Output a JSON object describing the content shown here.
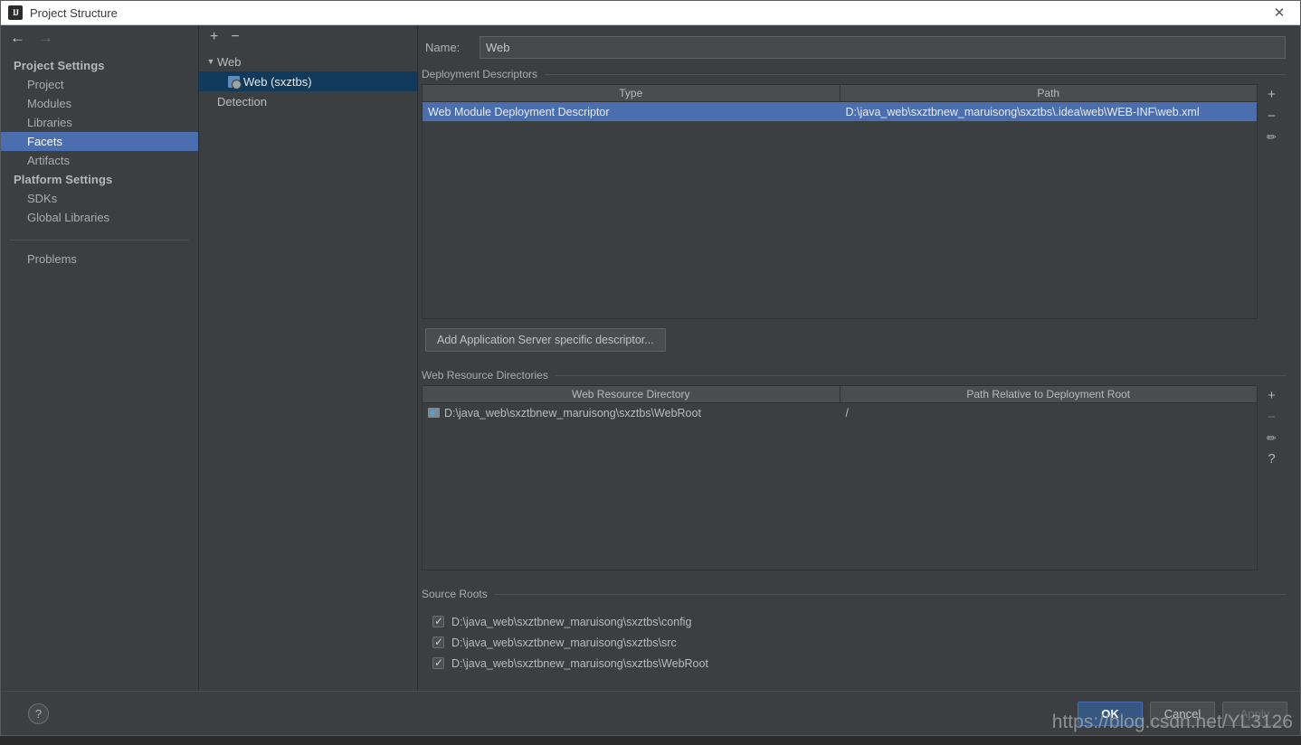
{
  "window": {
    "title": "Project Structure",
    "app_icon": "IJ",
    "close_icon": "close-icon"
  },
  "nav": {
    "back_icon": "←",
    "forward_icon": "→",
    "groups": [
      {
        "label": "Project Settings",
        "items": [
          {
            "label": "Project",
            "selected": false
          },
          {
            "label": "Modules",
            "selected": false
          },
          {
            "label": "Libraries",
            "selected": false
          },
          {
            "label": "Facets",
            "selected": true
          },
          {
            "label": "Artifacts",
            "selected": false
          }
        ]
      },
      {
        "label": "Platform Settings",
        "items": [
          {
            "label": "SDKs",
            "selected": false
          },
          {
            "label": "Global Libraries",
            "selected": false
          }
        ]
      }
    ],
    "extra": [
      {
        "label": "Problems",
        "selected": false
      }
    ]
  },
  "tree": {
    "toolbar": {
      "add": "+",
      "remove": "−"
    },
    "nodes": [
      {
        "label": "Web",
        "type": "group",
        "expanded": true,
        "selected": false
      },
      {
        "label": "Web (sxztbs)",
        "type": "facet",
        "selected": true
      },
      {
        "label": "Detection",
        "type": "group",
        "selected": false
      }
    ]
  },
  "content": {
    "name_label": "Name:",
    "name_value": "Web",
    "deployment": {
      "title": "Deployment Descriptors",
      "columns": [
        "Type",
        "Path"
      ],
      "rows": [
        {
          "type": "Web Module Deployment Descriptor",
          "path": "D:\\java_web\\sxztbnew_maruisong\\sxztbs\\.idea\\web\\WEB-INF\\web.xml",
          "selected": true
        }
      ],
      "tools": [
        "+",
        "−",
        "pencil-icon"
      ],
      "add_button": "Add Application Server specific descriptor..."
    },
    "web_resources": {
      "title": "Web Resource Directories",
      "columns": [
        "Web Resource Directory",
        "Path Relative to Deployment Root"
      ],
      "rows": [
        {
          "directory": "D:\\java_web\\sxztbnew_maruisong\\sxztbs\\WebRoot",
          "relative": "/",
          "selected": false
        }
      ],
      "tools": [
        "+",
        "−",
        "pencil-icon",
        "?"
      ]
    },
    "source_roots": {
      "title": "Source Roots",
      "items": [
        {
          "label": "D:\\java_web\\sxztbnew_maruisong\\sxztbs\\config",
          "checked": true
        },
        {
          "label": "D:\\java_web\\sxztbnew_maruisong\\sxztbs\\src",
          "checked": true
        },
        {
          "label": "D:\\java_web\\sxztbnew_maruisong\\sxztbs\\WebRoot",
          "checked": true
        }
      ]
    }
  },
  "footer": {
    "help": "?",
    "ok": "OK",
    "cancel": "Cancel",
    "apply": "Apply"
  },
  "watermark": "https://blog.csdn.net/YL3126",
  "colors": {
    "dialog_bg": "#3c3f41",
    "selection_blue": "#4b6eaf",
    "tree_selection": "#113a5c",
    "primary_button": "#365880",
    "title_bar": "#ffffff"
  }
}
